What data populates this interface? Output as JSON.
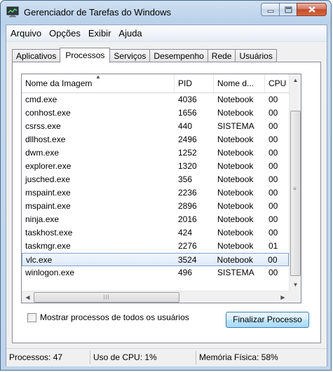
{
  "window": {
    "title": "Gerenciador de Tarefas do Windows",
    "icon": "task-manager-icon"
  },
  "menu": [
    "Arquivo",
    "Opções",
    "Exibir",
    "Ajuda"
  ],
  "tabs": [
    {
      "label": "Aplicativos",
      "active": false
    },
    {
      "label": "Processos",
      "active": true
    },
    {
      "label": "Serviços",
      "active": false
    },
    {
      "label": "Desempenho",
      "active": false
    },
    {
      "label": "Rede",
      "active": false
    },
    {
      "label": "Usuários",
      "active": false
    }
  ],
  "table": {
    "columns": [
      "Nome da Imagem",
      "PID",
      "Nome d...",
      "CPU"
    ],
    "sort_indicator": "▲",
    "rows": [
      {
        "name": "cmd.exe",
        "pid": "4036",
        "user": "Notebook",
        "cpu": "00"
      },
      {
        "name": "conhost.exe",
        "pid": "1656",
        "user": "Notebook",
        "cpu": "00"
      },
      {
        "name": "csrss.exe",
        "pid": "440",
        "user": "SISTEMA",
        "cpu": "00"
      },
      {
        "name": "dllhost.exe",
        "pid": "2496",
        "user": "Notebook",
        "cpu": "00"
      },
      {
        "name": "dwm.exe",
        "pid": "1252",
        "user": "Notebook",
        "cpu": "00"
      },
      {
        "name": "explorer.exe",
        "pid": "1320",
        "user": "Notebook",
        "cpu": "00"
      },
      {
        "name": "jusched.exe",
        "pid": "356",
        "user": "Notebook",
        "cpu": "00"
      },
      {
        "name": "mspaint.exe",
        "pid": "2236",
        "user": "Notebook",
        "cpu": "00"
      },
      {
        "name": "mspaint.exe",
        "pid": "2896",
        "user": "Notebook",
        "cpu": "00"
      },
      {
        "name": "ninja.exe",
        "pid": "2016",
        "user": "Notebook",
        "cpu": "00"
      },
      {
        "name": "taskhost.exe",
        "pid": "424",
        "user": "Notebook",
        "cpu": "00"
      },
      {
        "name": "taskmgr.exe",
        "pid": "2276",
        "user": "Notebook",
        "cpu": "01"
      },
      {
        "name": "vlc.exe",
        "pid": "3524",
        "user": "Notebook",
        "cpu": "00",
        "selected": true
      },
      {
        "name": "winlogon.exe",
        "pid": "496",
        "user": "SISTEMA",
        "cpu": "00"
      }
    ]
  },
  "show_all_label": "Mostrar processos de todos os usuários",
  "end_process_label": "Finalizar Processo",
  "status": {
    "processes": "Processos: 47",
    "cpu": "Uso de CPU: 1%",
    "memory": "Memória Física: 58%"
  }
}
